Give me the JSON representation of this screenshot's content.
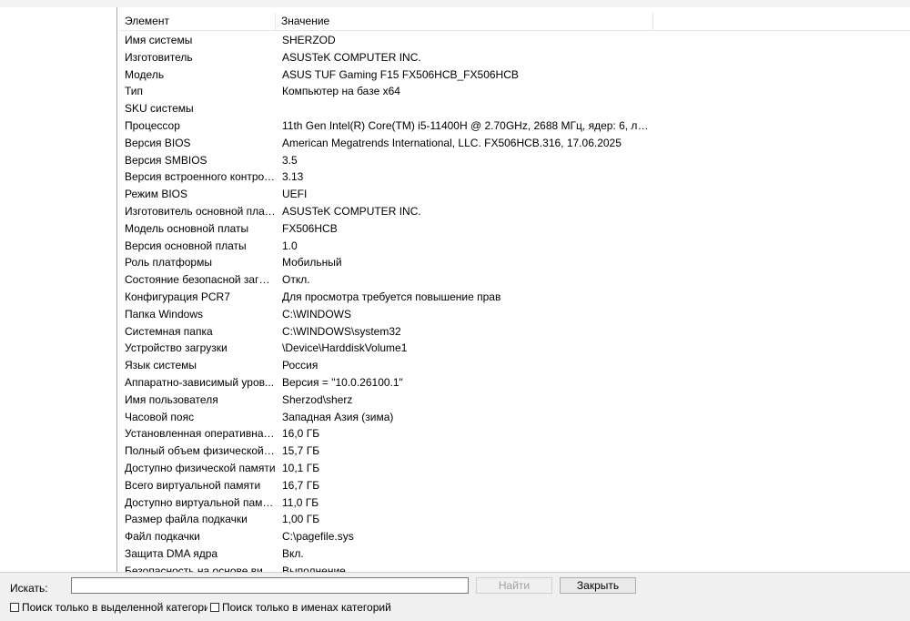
{
  "table": {
    "header": {
      "item": "Элемент",
      "value": "Значение"
    },
    "rows": [
      {
        "item": "Имя системы",
        "value": "SHERZOD"
      },
      {
        "item": "Изготовитель",
        "value": "ASUSTeK COMPUTER INC."
      },
      {
        "item": "Модель",
        "value": "ASUS TUF Gaming F15 FX506HCB_FX506HCB"
      },
      {
        "item": "Тип",
        "value": "Компьютер на базе x64"
      },
      {
        "item": "SKU системы",
        "value": ""
      },
      {
        "item": "Процессор",
        "value": "11th Gen Intel(R) Core(TM) i5-11400H @ 2.70GHz, 2688 МГц, ядер: 6, логи..."
      },
      {
        "item": "Версия BIOS",
        "value": "American Megatrends International, LLC. FX506HCB.316, 17.06.2025"
      },
      {
        "item": "Версия SMBIOS",
        "value": "3.5"
      },
      {
        "item": "Версия встроенного контрол...",
        "value": "3.13"
      },
      {
        "item": "Режим BIOS",
        "value": "UEFI"
      },
      {
        "item": "Изготовитель основной платы",
        "value": "ASUSTeK COMPUTER INC."
      },
      {
        "item": "Модель основной платы",
        "value": "FX506HCB"
      },
      {
        "item": "Версия основной платы",
        "value": "1.0"
      },
      {
        "item": "Роль платформы",
        "value": "Мобильный"
      },
      {
        "item": "Состояние безопасной загру...",
        "value": "Откл."
      },
      {
        "item": "Конфигурация PCR7",
        "value": "Для просмотра требуется повышение прав"
      },
      {
        "item": "Папка Windows",
        "value": "C:\\WINDOWS"
      },
      {
        "item": "Системная папка",
        "value": "C:\\WINDOWS\\system32"
      },
      {
        "item": "Устройство загрузки",
        "value": "\\Device\\HarddiskVolume1"
      },
      {
        "item": "Язык системы",
        "value": "Россия"
      },
      {
        "item": "Аппаратно-зависимый уров...",
        "value": "Версия = \"10.0.26100.1\""
      },
      {
        "item": "Имя пользователя",
        "value": "Sherzod\\sherz"
      },
      {
        "item": "Часовой пояс",
        "value": "Западная Азия (зима)"
      },
      {
        "item": "Установленная оперативная...",
        "value": "16,0 ГБ"
      },
      {
        "item": "Полный объем физической ...",
        "value": "15,7 ГБ"
      },
      {
        "item": "Доступно физической памяти",
        "value": "10,1 ГБ"
      },
      {
        "item": "Всего виртуальной памяти",
        "value": "16,7 ГБ"
      },
      {
        "item": "Доступно виртуальной памя...",
        "value": "11,0 ГБ"
      },
      {
        "item": "Размер файла подкачки",
        "value": "1,00 ГБ"
      },
      {
        "item": "Файл подкачки",
        "value": "C:\\pagefile.sys"
      },
      {
        "item": "Защита DMA ядра",
        "value": "Вкл."
      },
      {
        "item": "Безопасность на основе вир...",
        "value": "Выполнение"
      }
    ]
  },
  "search": {
    "label": "Искать:",
    "value": "",
    "find_label": "Найти",
    "close_label": "Закрыть",
    "only_selected_label": "Поиск только в выделенной категории",
    "only_names_label": "Поиск только в именах категорий"
  }
}
